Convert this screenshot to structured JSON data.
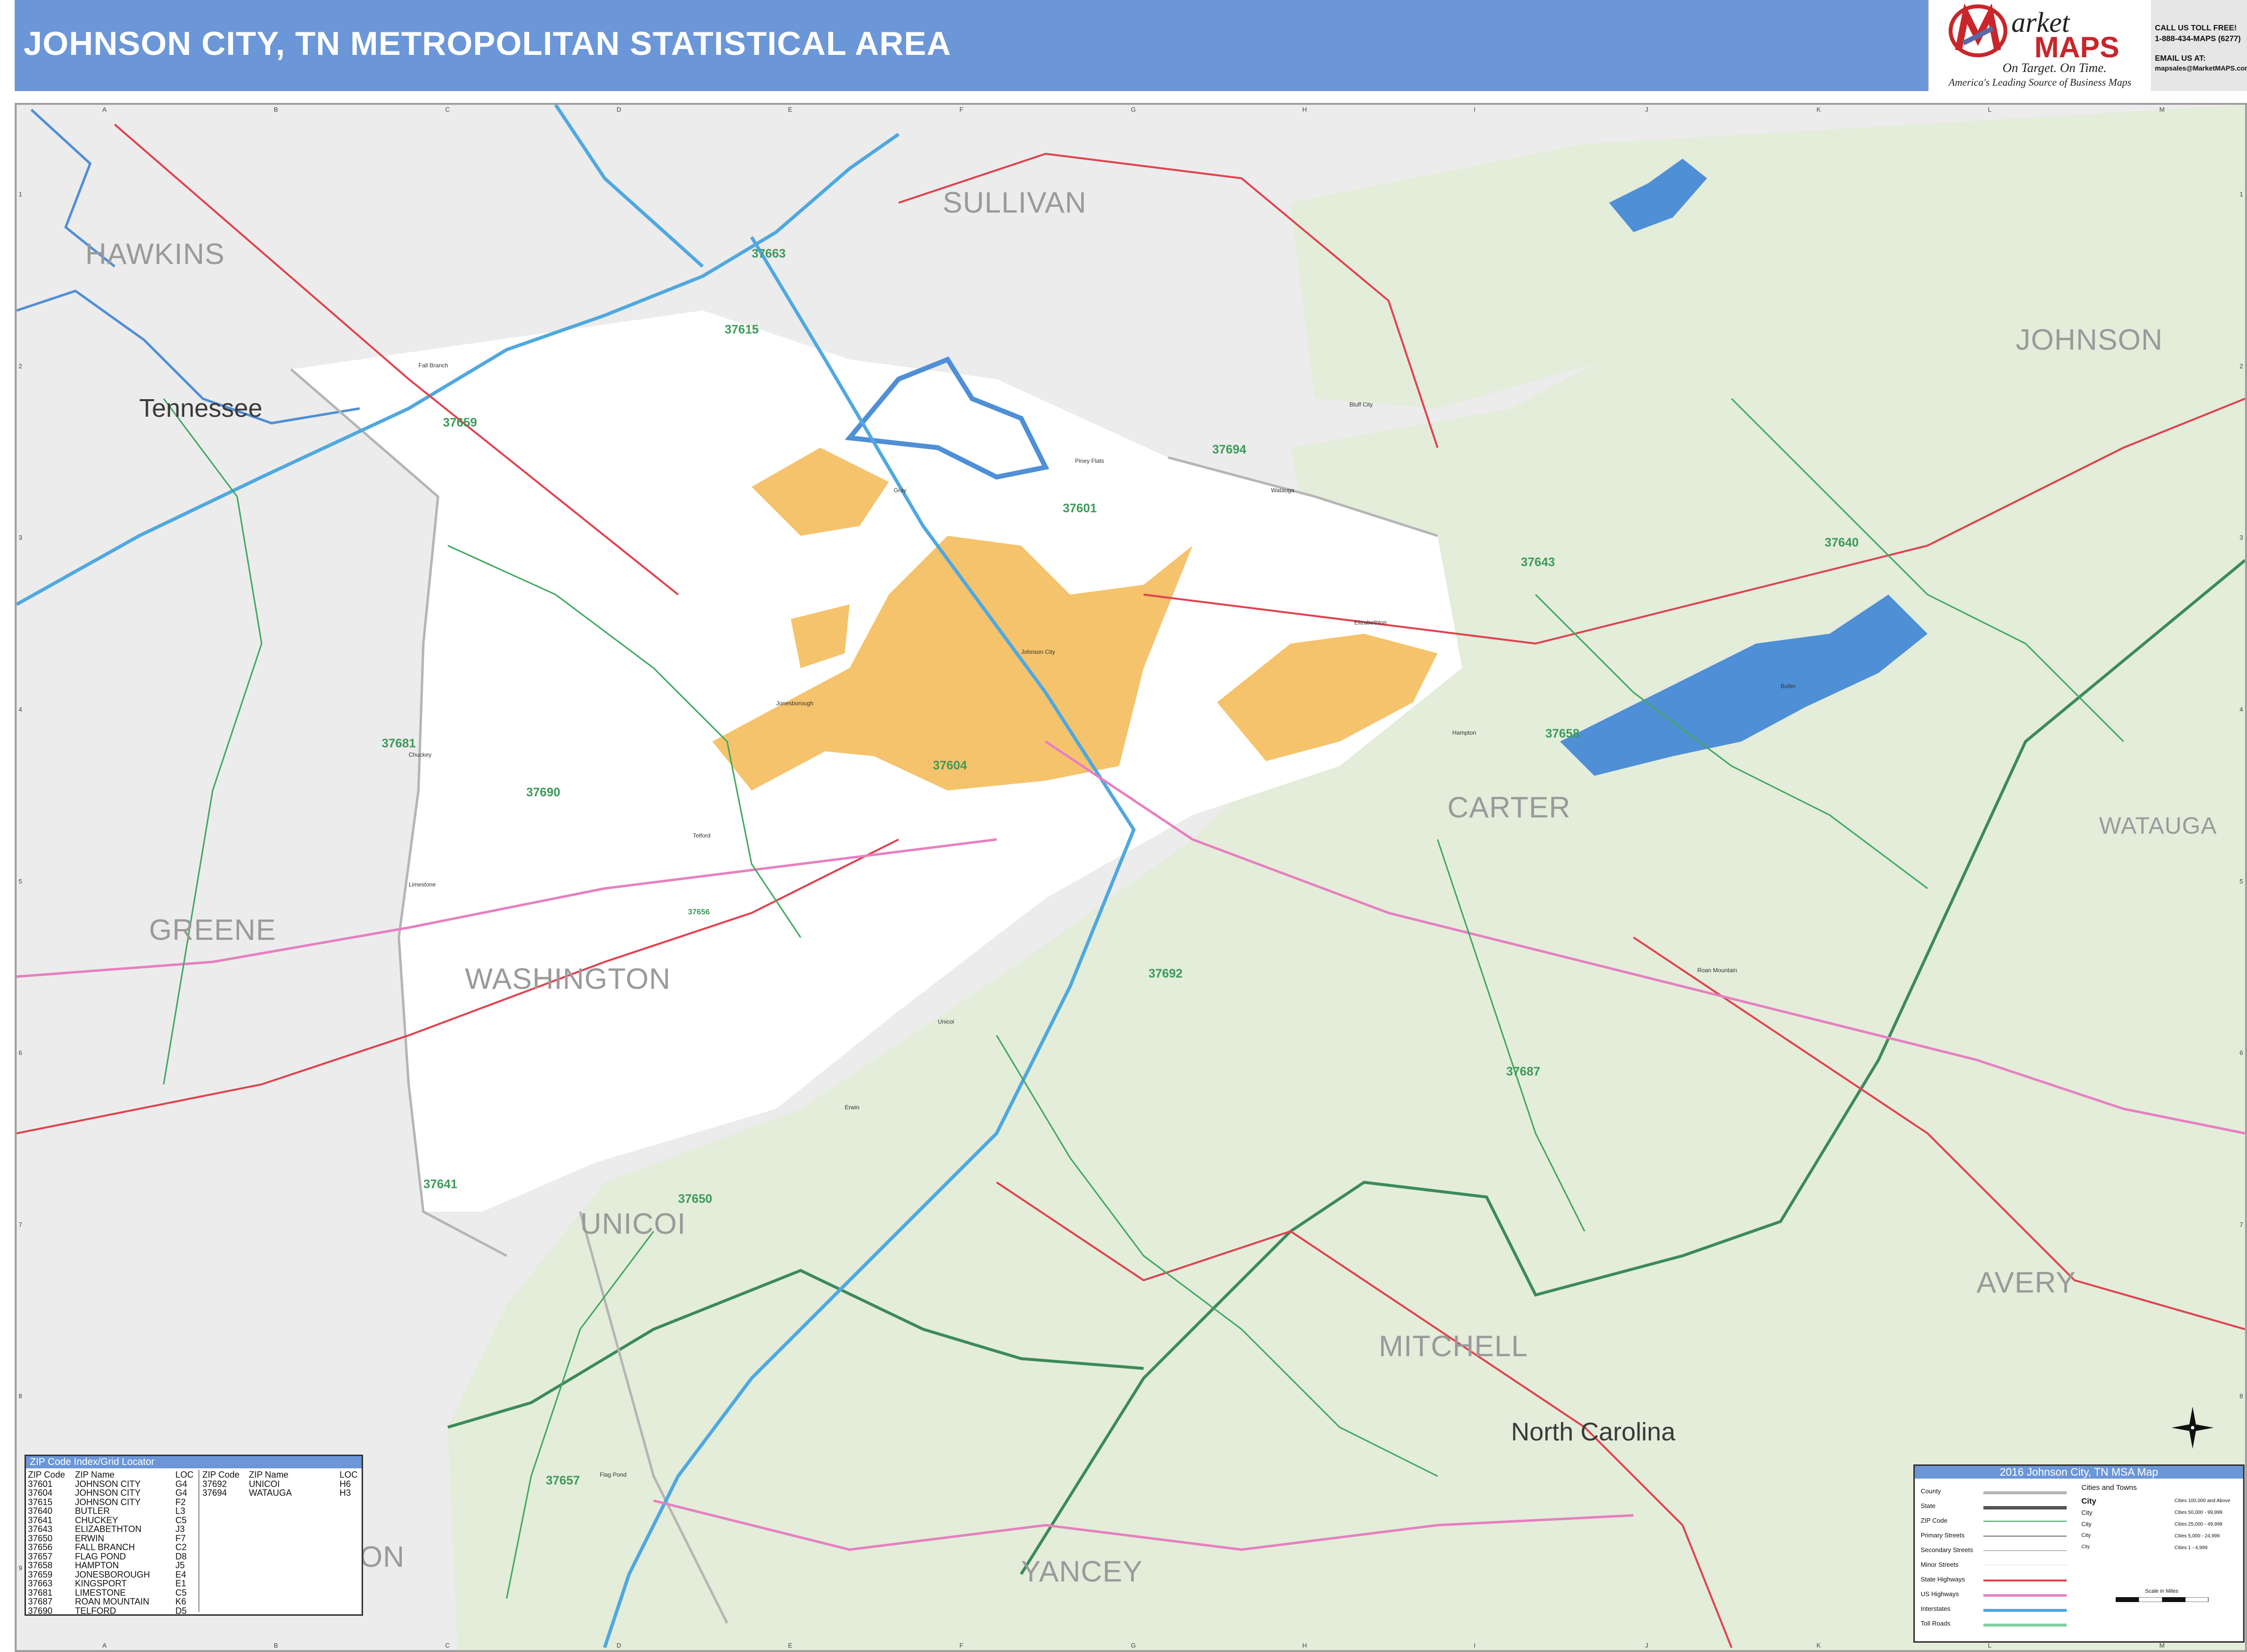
{
  "header": {
    "title": "JOHNSON CITY, TN METROPOLITAN STATISTICAL AREA"
  },
  "logo": {
    "letter_m": "M",
    "word_arket": "arket",
    "word_maps": "MAPS",
    "slogan": "On Target. On Time.",
    "tagline": "America's Leading Source of Business Maps"
  },
  "contact": {
    "line1": "CALL US TOLL FREE!",
    "line2": "1-888-434-MAPS (6277)",
    "line3": "EMAIL US AT:",
    "line4": "mapsales@MarketMAPS.com"
  },
  "grid": {
    "letters": [
      "A",
      "B",
      "C",
      "D",
      "E",
      "F",
      "G",
      "H",
      "I",
      "J",
      "K",
      "L",
      "M"
    ],
    "numbers": [
      "1",
      "2",
      "3",
      "4",
      "5",
      "6",
      "7",
      "8",
      "9"
    ]
  },
  "map": {
    "colors": {
      "msa_fill": "#ffffff",
      "city_fill": "#f5c36b",
      "forest_fill": "#e3edda",
      "outside_fill": "#ececec",
      "water": "#4f8fd6",
      "zip_boundary": "#3fa860",
      "state_highway": "#e0434f",
      "us_highway": "#e77fc0",
      "interstate": "#4fa8e0",
      "state_boundary": "#3c8a5a",
      "county_boundary": "#b5b5b5"
    },
    "states": [
      "Tennessee",
      "North Carolina"
    ],
    "counties": [
      "HAWKINS",
      "SULLIVAN",
      "JOHNSON",
      "GREENE",
      "WASHINGTON",
      "CARTER",
      "WATAUGA",
      "UNICOI",
      "AVERY",
      "MITCHELL",
      "YANCEY",
      "ON"
    ],
    "zip_codes": [
      "37663",
      "37615",
      "37659",
      "37694",
      "37601",
      "37643",
      "37640",
      "37658",
      "37681",
      "37690",
      "37604",
      "37656",
      "37692",
      "37687",
      "37641",
      "37650",
      "37657"
    ],
    "places": [
      "Fall Branch",
      "Johnson City",
      "Elizabethton",
      "Jonesborough",
      "Erwin",
      "Telford",
      "Limestone",
      "Roan Mountain",
      "Gray",
      "Watauga",
      "Piney Flats",
      "Unicoi",
      "Flag Pond",
      "Chuckey",
      "Hampton",
      "Butler",
      "Bluff City"
    ]
  },
  "zip_index": {
    "title": "ZIP Code Index/Grid Locator",
    "headers": {
      "zip": "ZIP Code",
      "name": "ZIP Name",
      "loc": "LOC"
    },
    "left": [
      {
        "zip": "37601",
        "name": "JOHNSON CITY",
        "loc": "G4"
      },
      {
        "zip": "37604",
        "name": "JOHNSON CITY",
        "loc": "G4"
      },
      {
        "zip": "37615",
        "name": "JOHNSON CITY",
        "loc": "F2"
      },
      {
        "zip": "37640",
        "name": "BUTLER",
        "loc": "L3"
      },
      {
        "zip": "37641",
        "name": "CHUCKEY",
        "loc": "C5"
      },
      {
        "zip": "37643",
        "name": "ELIZABETHTON",
        "loc": "J3"
      },
      {
        "zip": "37650",
        "name": "ERWIN",
        "loc": "F7"
      },
      {
        "zip": "37656",
        "name": "FALL BRANCH",
        "loc": "C2"
      },
      {
        "zip": "37657",
        "name": "FLAG POND",
        "loc": "D8"
      },
      {
        "zip": "37658",
        "name": "HAMPTON",
        "loc": "J5"
      },
      {
        "zip": "37659",
        "name": "JONESBOROUGH",
        "loc": "E4"
      },
      {
        "zip": "37663",
        "name": "KINGSPORT",
        "loc": "E1"
      },
      {
        "zip": "37681",
        "name": "LIMESTONE",
        "loc": "C5"
      },
      {
        "zip": "37687",
        "name": "ROAN MOUNTAIN",
        "loc": "K6"
      },
      {
        "zip": "37690",
        "name": "TELFORD",
        "loc": "D5"
      }
    ],
    "right": [
      {
        "zip": "37692",
        "name": "UNICOI",
        "loc": "H6"
      },
      {
        "zip": "37694",
        "name": "WATAUGA",
        "loc": "H3"
      }
    ]
  },
  "legend": {
    "title": "2016 Johnson City, TN MSA Map",
    "items": [
      "County",
      "State",
      "ZIP Code",
      "Primary Streets",
      "Secondary Streets",
      "Minor Streets",
      "State Highways",
      "US Highways",
      "Interstates",
      "Toll Roads"
    ],
    "cities_title": "Cities and Towns",
    "cities": [
      {
        "label": "City",
        "desc": "Cities 100,000 and Above"
      },
      {
        "label": "City",
        "desc": "Cities 50,000 - 99,999"
      },
      {
        "label": "City",
        "desc": "Cities 25,000 - 49,999"
      },
      {
        "label": "City",
        "desc": "Cities 5,000 - 24,999"
      },
      {
        "label": "City",
        "desc": "Cities 1 - 4,999"
      }
    ],
    "scale_label": "Scale in Miles"
  }
}
